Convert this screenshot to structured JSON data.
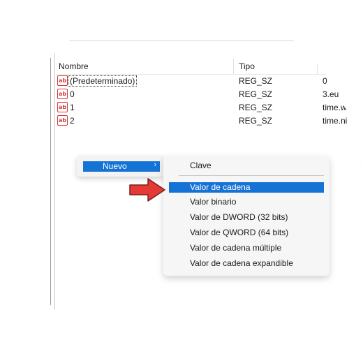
{
  "columns": {
    "name": "Nombre",
    "type": "Tipo"
  },
  "rows": [
    {
      "icon": "string-value-icon",
      "icon_text": "ab",
      "name": "(Predeterminado)",
      "type": "REG_SZ",
      "data": "0"
    },
    {
      "icon": "string-value-icon",
      "icon_text": "ab",
      "name": "0",
      "type": "REG_SZ",
      "data": "3.eu"
    },
    {
      "icon": "string-value-icon",
      "icon_text": "ab",
      "name": "1",
      "type": "REG_SZ",
      "data": "time.w"
    },
    {
      "icon": "string-value-icon",
      "icon_text": "ab",
      "name": "2",
      "type": "REG_SZ",
      "data": "time.ni"
    }
  ],
  "context_menu": {
    "label": "Nuevo",
    "arrow": "›"
  },
  "submenu": {
    "items": [
      "Clave",
      "Valor de cadena",
      "Valor binario",
      "Valor de DWORD (32 bits)",
      "Valor de QWORD (64 bits)",
      "Valor de cadena múltiple",
      "Valor de cadena expandible"
    ],
    "highlighted": "Valor de cadena"
  },
  "colors": {
    "highlight": "#1673d6",
    "arrow_red": "#e53935",
    "frame": "#e3e3e3"
  }
}
